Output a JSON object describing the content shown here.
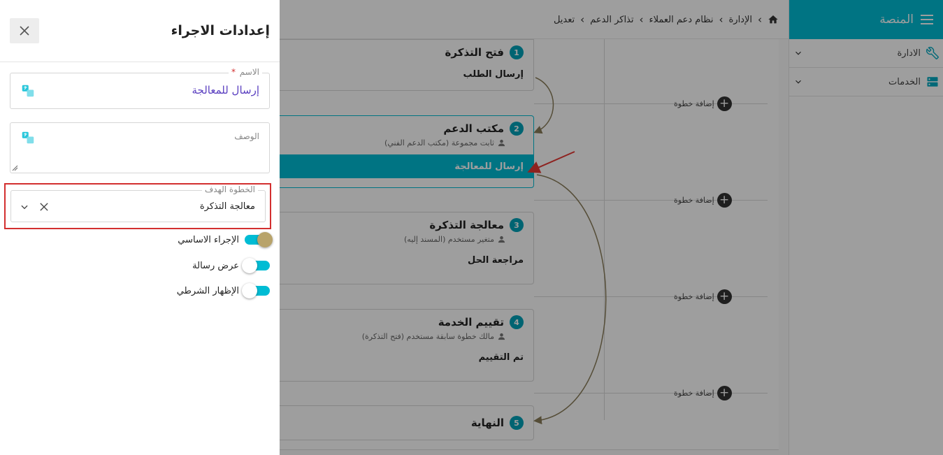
{
  "sidebar": {
    "title": "المنصة",
    "items": [
      {
        "label": "الادارة",
        "icon": "wrench-icon"
      },
      {
        "label": "الخدمات",
        "icon": "services-icon"
      }
    ]
  },
  "breadcrumb": [
    "الإدارة",
    "نظام دعم العملاء",
    "تذاكر الدعم",
    "تعديل"
  ],
  "steps": [
    {
      "num": "1",
      "title": "فتح التذكرة",
      "subtitle": "",
      "action": "إرسال الطلب"
    },
    {
      "num": "2",
      "title": "مكتب الدعم",
      "subtitle": "ثابت مجموعة (مكتب الدعم الفني)",
      "action": "إرسال للمعالجة"
    },
    {
      "num": "3",
      "title": "معالجة التذكرة",
      "subtitle": "متغير مستخدم (المسند إليه)",
      "action": "مراجعة الحل"
    },
    {
      "num": "4",
      "title": "تقييم الخدمة",
      "subtitle": "مالك خطوة سابقة مستخدم (فتح التذكرة)",
      "action": "تم التقييم"
    },
    {
      "num": "5",
      "title": "النهاية",
      "subtitle": "",
      "action": ""
    }
  ],
  "add_step_label": "إضافة خطوة",
  "drawer": {
    "title": "إعدادات الاجراء",
    "name_label": "الاسم",
    "name_required": "*",
    "name_value": "إرسال للمعالجة",
    "description_label": "الوصف",
    "target_label": "الخطوة الهدف",
    "target_value": "معالجة التذكرة",
    "toggles": [
      {
        "label": "الإجراء الاساسي",
        "on": true
      },
      {
        "label": "عرض رسالة",
        "on": false
      },
      {
        "label": "الإظهار الشرطي",
        "on": false
      }
    ]
  },
  "colors": {
    "accent": "#00bcd4",
    "step_number": "#00a2b8",
    "highlight_border": "#d32f2f",
    "connector": "#8a7d5a",
    "annotation_arrow": "#e53935"
  }
}
